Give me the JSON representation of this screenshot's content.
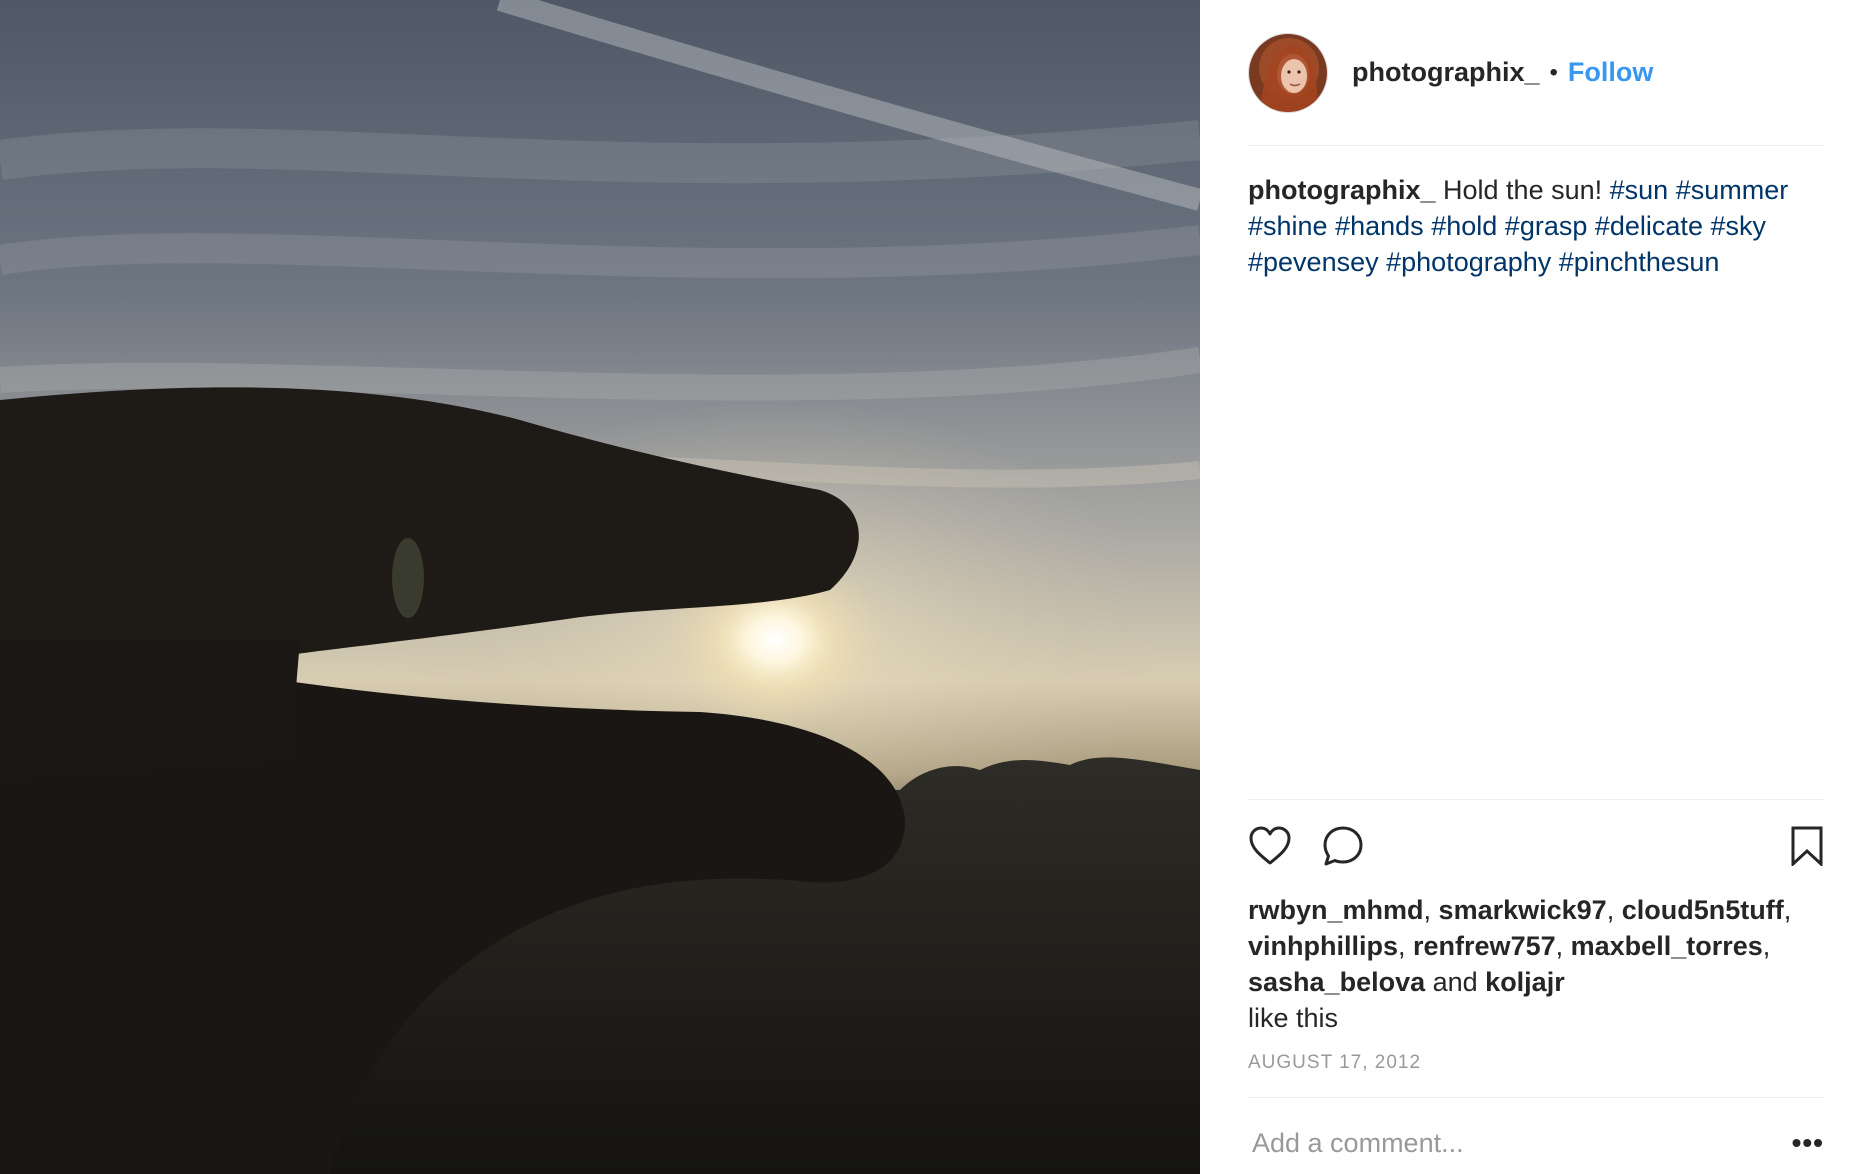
{
  "post": {
    "username": "photographix_",
    "separator": "•",
    "follow_label": "Follow",
    "caption": {
      "user": "photographix_",
      "text": "Hold the sun!",
      "hashtags": [
        "#sun",
        "#summer",
        "#shine",
        "#hands",
        "#hold",
        "#grasp",
        "#delicate",
        "#sky",
        "#pevensey",
        "#photography",
        "#pinchthesun"
      ]
    },
    "likes": {
      "users": [
        "rwbyn_mhmd",
        "smarkwick97",
        "cloud5n5tuff",
        "vinhphillips",
        "renfrew757",
        "maxbell_torres",
        "sasha_belova"
      ],
      "conjunction": "and",
      "last_user": "koljajr",
      "suffix": "like this"
    },
    "date": "AUGUST 17, 2012",
    "comment_placeholder": "Add a comment...",
    "more_label": "•••"
  },
  "colors": {
    "follow": "#3897f0",
    "hashtag": "#003569",
    "muted": "#999999",
    "divider": "#efefef"
  },
  "icons": {
    "like": "heart-icon",
    "comment": "speech-bubble-icon",
    "save": "bookmark-icon",
    "more": "ellipsis-icon"
  }
}
